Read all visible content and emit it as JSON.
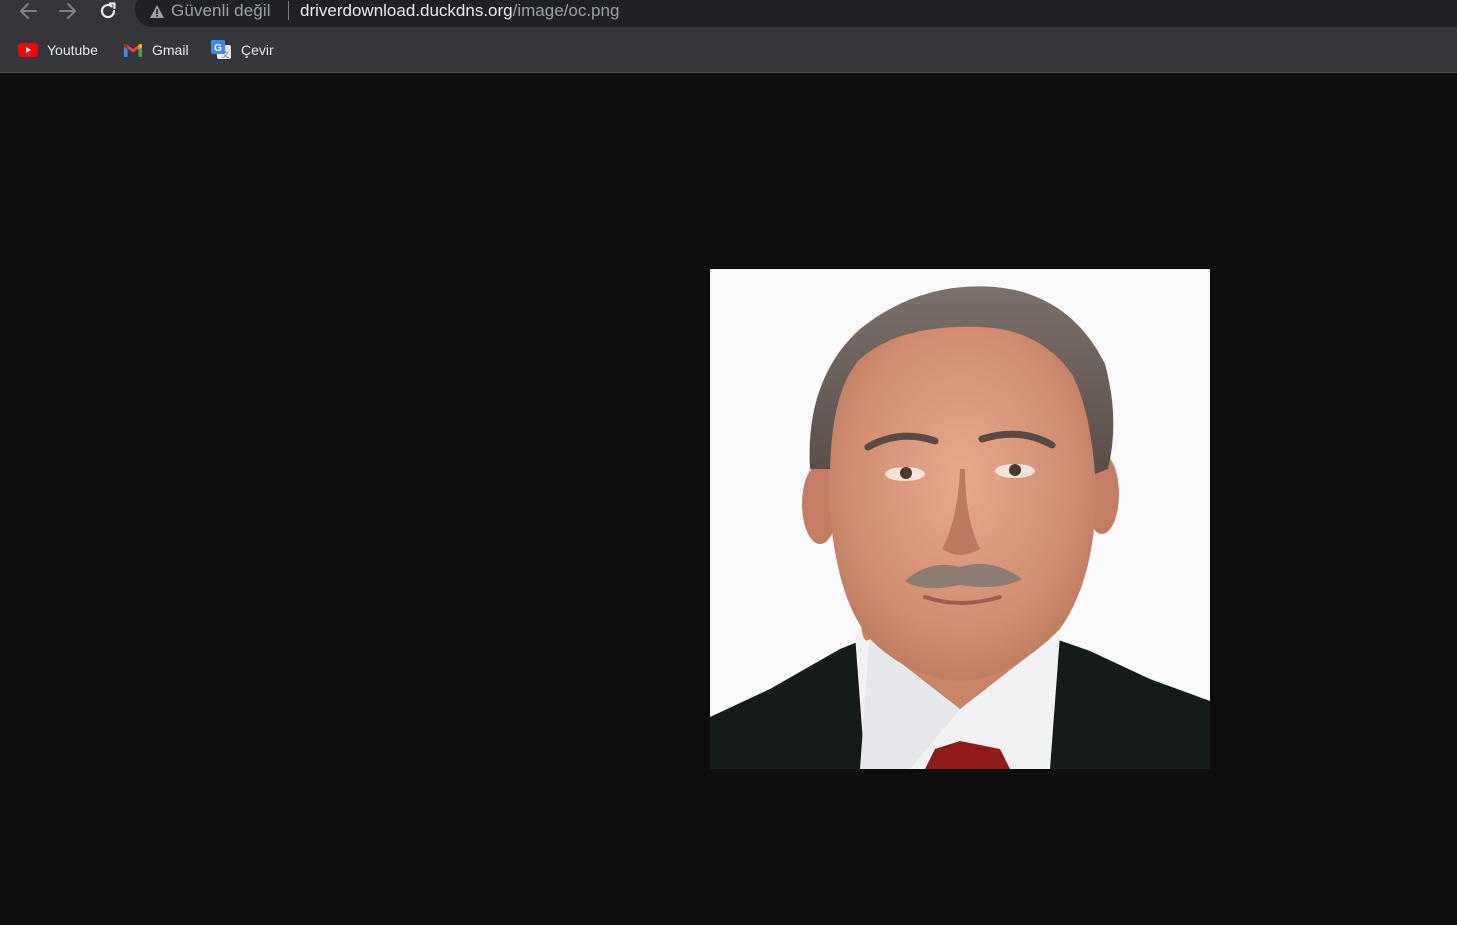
{
  "browser": {
    "nav": {
      "back_icon": "arrow-left-icon",
      "forward_icon": "arrow-right-icon",
      "reload_icon": "reload-icon"
    },
    "omnibox": {
      "security_label": "Güvenli değil",
      "security_icon": "warning-triangle-icon",
      "url_host": "driverdownload.duckdns.org",
      "url_path": "/image/oc.png"
    },
    "bookmarks": [
      {
        "label": "Youtube",
        "icon": "youtube-icon"
      },
      {
        "label": "Gmail",
        "icon": "gmail-icon"
      },
      {
        "label": "Çevir",
        "icon": "google-translate-icon"
      }
    ]
  },
  "viewer": {
    "image_file": "oc.png",
    "image_subject": "portrait photo",
    "background_color": "#0e0e0e"
  }
}
